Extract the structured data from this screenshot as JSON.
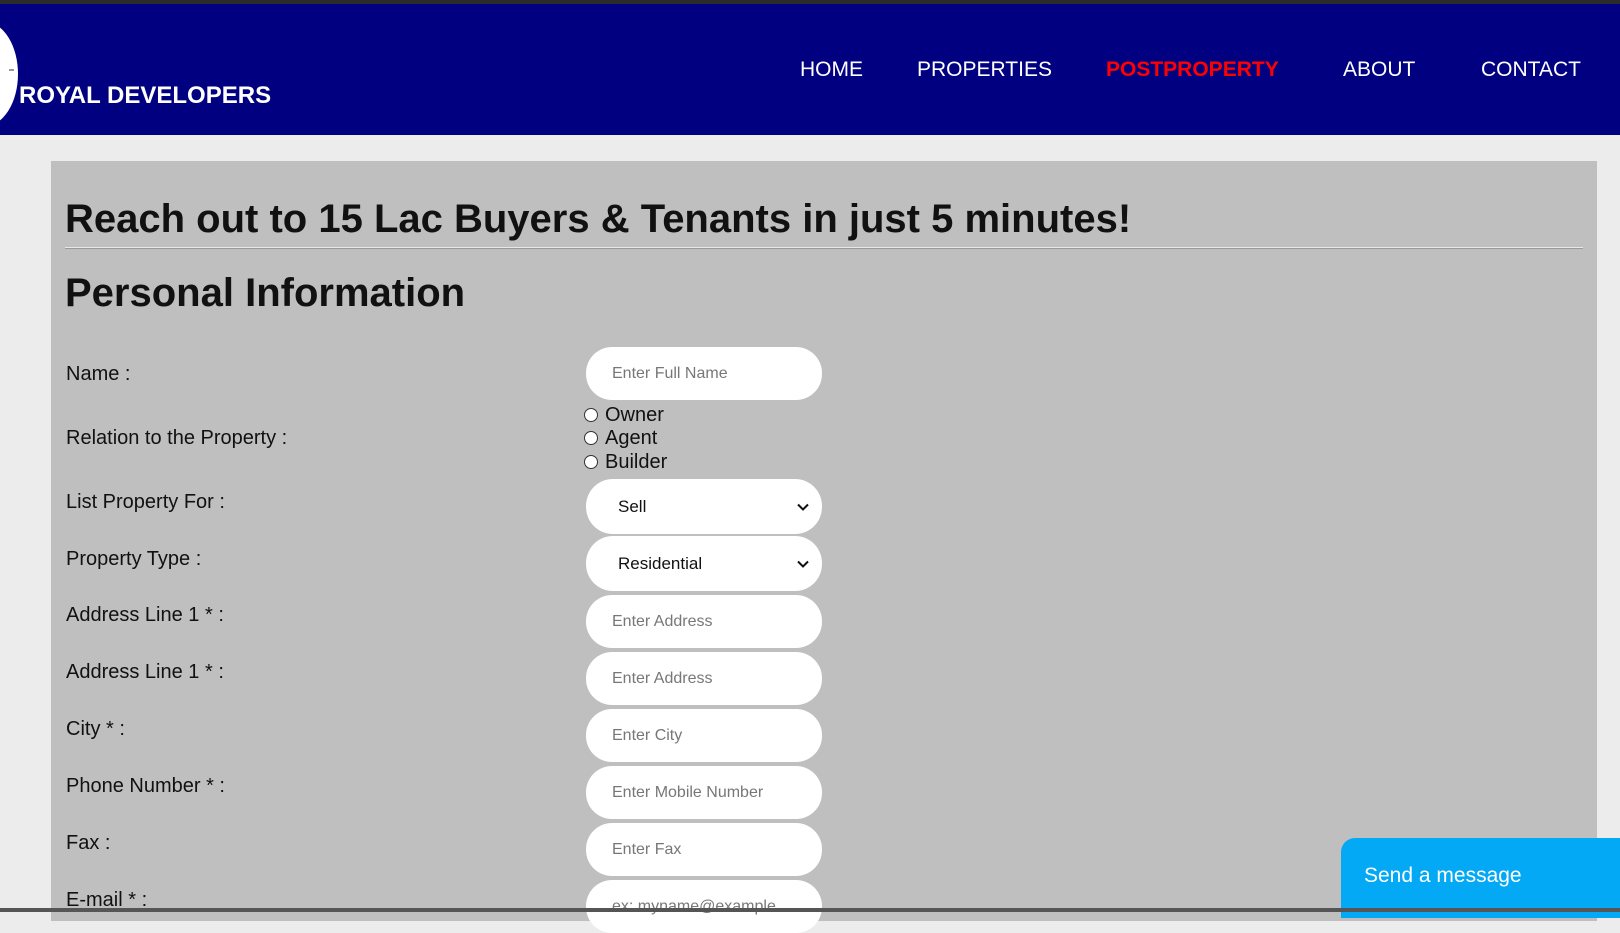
{
  "header": {
    "brand": "ROYAL DEVELOPERS",
    "nav": [
      {
        "label": "HOME",
        "active": false
      },
      {
        "label": "PROPERTIES",
        "active": false
      },
      {
        "label": "POSTPROPERTY",
        "active": true
      },
      {
        "label": "ABOUT",
        "active": false
      },
      {
        "label": "CONTACT",
        "active": false
      }
    ],
    "colors": {
      "background": "#000080",
      "active_link": "#ff0000"
    }
  },
  "main": {
    "headline": "Reach out to 15 Lac Buyers & Tenants in just 5 minutes!",
    "section_title": "Personal Information",
    "form": {
      "name": {
        "label": "Name :",
        "placeholder": "Enter Full Name"
      },
      "relation": {
        "label": "Relation to the Property :",
        "options": [
          "Owner",
          "Agent",
          "Builder"
        ]
      },
      "list_for": {
        "label": "List Property For :",
        "value": "Sell"
      },
      "property_type": {
        "label": "Property Type :",
        "value": "Residential"
      },
      "address1": {
        "label": "Address Line 1 * :",
        "placeholder": "Enter Address"
      },
      "address2": {
        "label": "Address Line 1 * :",
        "placeholder": "Enter Address"
      },
      "city": {
        "label": "City * :",
        "placeholder": "Enter City"
      },
      "phone": {
        "label": "Phone Number * :",
        "placeholder": "Enter Mobile Number"
      },
      "fax": {
        "label": "Fax :",
        "placeholder": "Enter Fax"
      },
      "email": {
        "label": "E-mail * :",
        "placeholder": "ex: myname@example"
      }
    }
  },
  "chat_widget": {
    "label": "Send a message",
    "color": "#03a9f4"
  }
}
